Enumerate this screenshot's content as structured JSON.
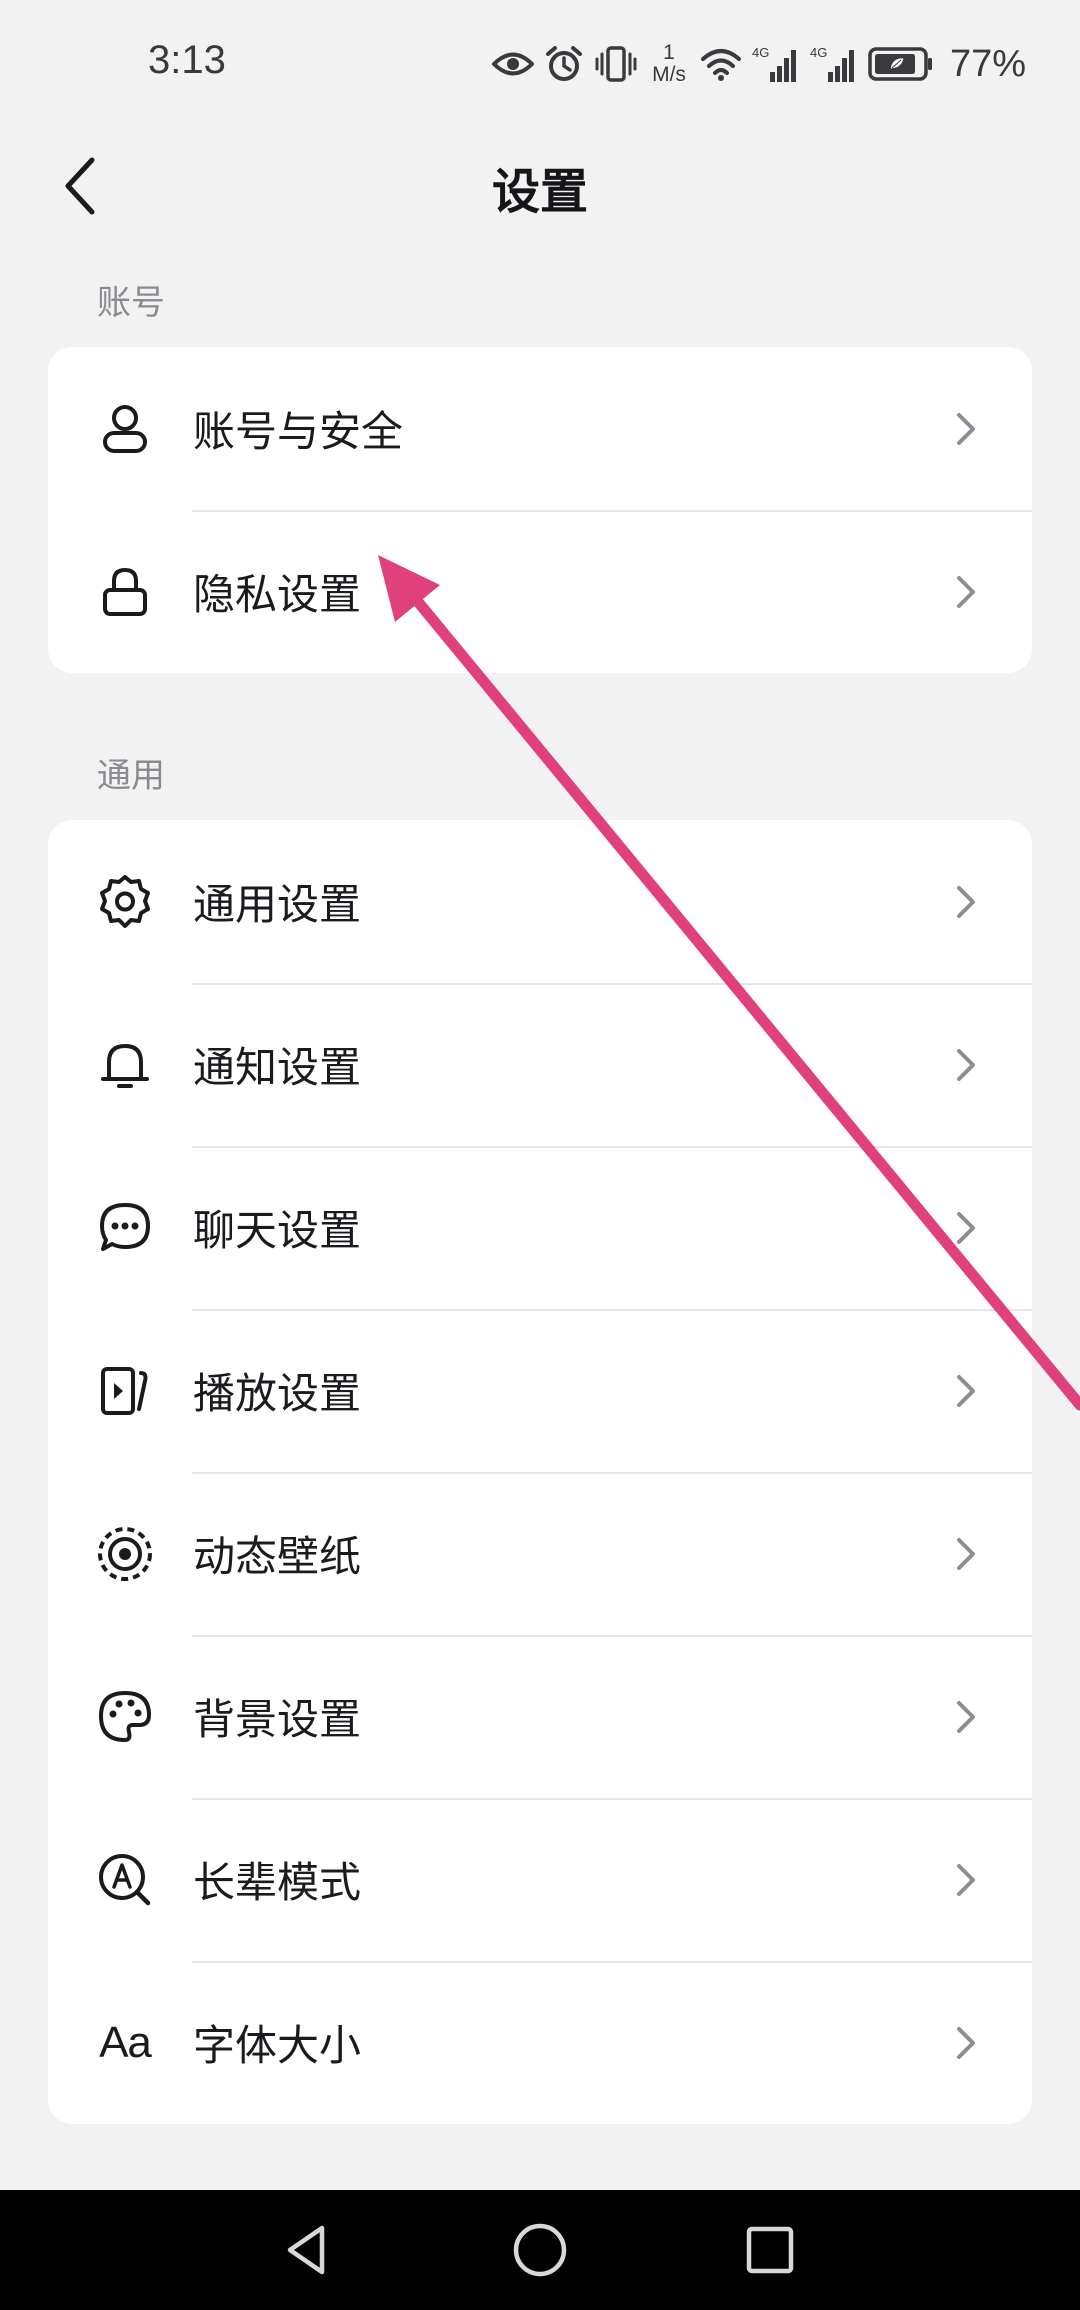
{
  "status_bar": {
    "time": "3:13",
    "speed_top": "1",
    "speed_unit": "M/s",
    "network_1": "4G",
    "network_2": "4G",
    "battery": "77%"
  },
  "header": {
    "title": "设置"
  },
  "sections": [
    {
      "label": "账号",
      "items": [
        {
          "label": "账号与安全",
          "icon": "user-icon"
        },
        {
          "label": "隐私设置",
          "icon": "lock-icon"
        }
      ]
    },
    {
      "label": "通用",
      "items": [
        {
          "label": "通用设置",
          "icon": "gear-icon"
        },
        {
          "label": "通知设置",
          "icon": "bell-icon"
        },
        {
          "label": "聊天设置",
          "icon": "chat-bubble-icon"
        },
        {
          "label": "播放设置",
          "icon": "play-screen-icon"
        },
        {
          "label": "动态壁纸",
          "icon": "live-wallpaper-icon"
        },
        {
          "label": "背景设置",
          "icon": "palette-icon"
        },
        {
          "label": "长辈模式",
          "icon": "elder-mode-icon"
        },
        {
          "label": "字体大小",
          "icon": "font-size-icon",
          "icon_text": "Aa"
        }
      ]
    }
  ],
  "colors": {
    "background": "#f2f2f3",
    "card": "#ffffff",
    "annotation_arrow": "#e0417a"
  }
}
